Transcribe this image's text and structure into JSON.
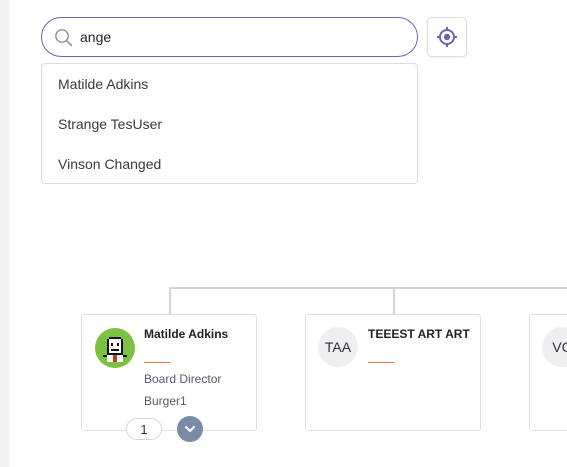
{
  "search": {
    "value": "ange",
    "results": [
      "Matilde Adkins",
      "Strange TesUser",
      "Vinson Changed"
    ]
  },
  "cards": [
    {
      "name": "Matilde Adkins",
      "title": "Board Director",
      "org": "Burger1",
      "count": "1",
      "avatar": "pixel-avatar"
    },
    {
      "name": "TEEEST ART ART",
      "initials": "TAA"
    },
    {
      "initials": "VC"
    }
  ],
  "colors": {
    "accent": "#6f63b0",
    "rule": "#f07a44",
    "expand": "#7a8ba6"
  },
  "icons": {
    "search": "search-icon",
    "locate": "crosshair-icon",
    "expand": "chevron-down-icon"
  }
}
